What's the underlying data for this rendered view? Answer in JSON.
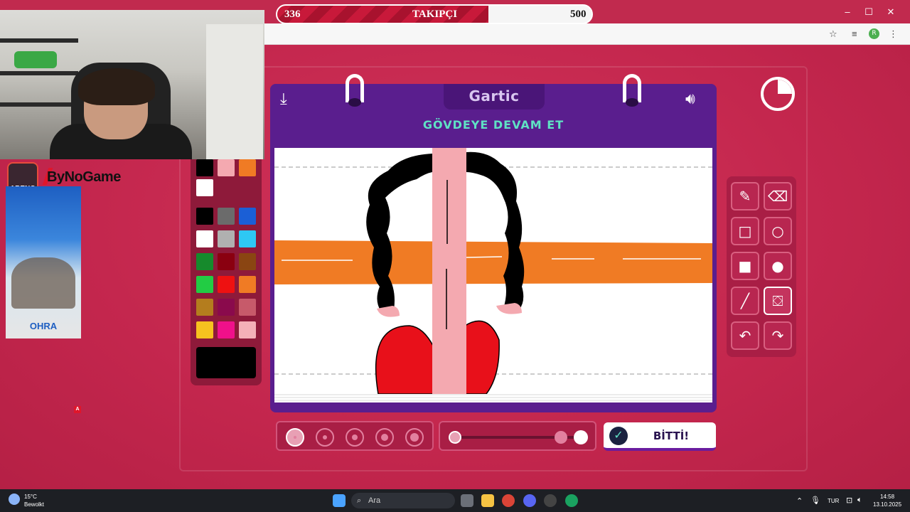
{
  "browser": {
    "account_initial": "R",
    "window_controls": [
      "–",
      "☐",
      "✕"
    ]
  },
  "follower_bar": {
    "current": "336",
    "label": "TAKIPÇI",
    "goal": "500",
    "progress_fraction": 0.672
  },
  "stream_overlay": {
    "brand_badge": "ARENO",
    "brand_name": "ByNoGame",
    "ad_brand": "OHRA",
    "corner_mark": "A"
  },
  "game": {
    "logo": "Gartic",
    "prompt": "GÖVDEYE DEVAM ET",
    "done_label": "BİTTİ!",
    "palette": {
      "top_row": [
        "#000000",
        "#f4a9b0",
        "#f07b24"
      ],
      "top_row2": [
        "#ffffff"
      ],
      "grid": [
        [
          "#000000",
          "#6b6b6b",
          "#1b5fd6"
        ],
        [
          "#ffffff",
          "#b0b0b0",
          "#2ec8f4"
        ],
        [
          "#168a2c",
          "#8a0010",
          "#8a4512"
        ],
        [
          "#22cc44",
          "#ee1111",
          "#f07b24"
        ],
        [
          "#b47d1e",
          "#8a0a4c",
          "#c75a6a"
        ],
        [
          "#f6c21f",
          "#f0108a",
          "#f4b0b8"
        ]
      ],
      "current_color": "#000000"
    },
    "tools": [
      {
        "name": "pencil-icon",
        "glyph": "✎"
      },
      {
        "name": "eraser-icon",
        "glyph": "⌫"
      },
      {
        "name": "rect-outline-icon",
        "glyph": "□"
      },
      {
        "name": "ellipse-outline-icon",
        "glyph": "○"
      },
      {
        "name": "rect-filled-icon",
        "glyph": "■"
      },
      {
        "name": "ellipse-filled-icon",
        "glyph": "●"
      },
      {
        "name": "line-icon",
        "glyph": "╱"
      },
      {
        "name": "fill-bucket-icon",
        "glyph": "⛋"
      },
      {
        "name": "undo-icon",
        "glyph": "↶"
      },
      {
        "name": "redo-icon",
        "glyph": "↷"
      }
    ],
    "active_tool": "fill-bucket-icon",
    "brush_sizes": [
      1,
      2,
      3,
      4,
      5
    ],
    "selected_brush_size": 1,
    "opacity_level": 0.9,
    "timer_fraction_elapsed": 0.25,
    "colors": {
      "board": "#5a1e8e",
      "prompt": "#5fe2c4",
      "background": "#c8284f"
    }
  },
  "taskbar": {
    "weather_temp": "15°C",
    "weather_desc": "Bewolkt",
    "search_placeholder": "Ara",
    "language": "TUR",
    "time": "14:58",
    "date": "13.10.2025"
  }
}
